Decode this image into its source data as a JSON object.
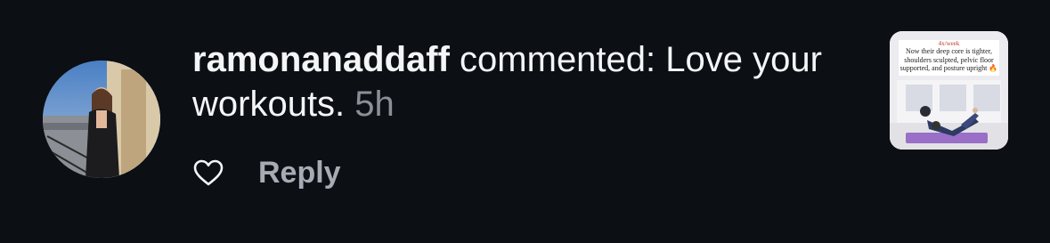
{
  "comment": {
    "username": "ramonanaddaff",
    "text": " commented: Love your workouts.",
    "time": "5h"
  },
  "actions": {
    "like_icon": "heart-outline-icon",
    "reply_label": "Reply"
  },
  "thumbnail": {
    "top_text": "4x/week",
    "caption": "Now their deep core is tighter, shoulders sculpted, pelvic floor supported, and posture upright 🔥"
  },
  "colors": {
    "background": "#0c0f14",
    "text": "#f4f5f7",
    "muted": "#8a8f98"
  }
}
